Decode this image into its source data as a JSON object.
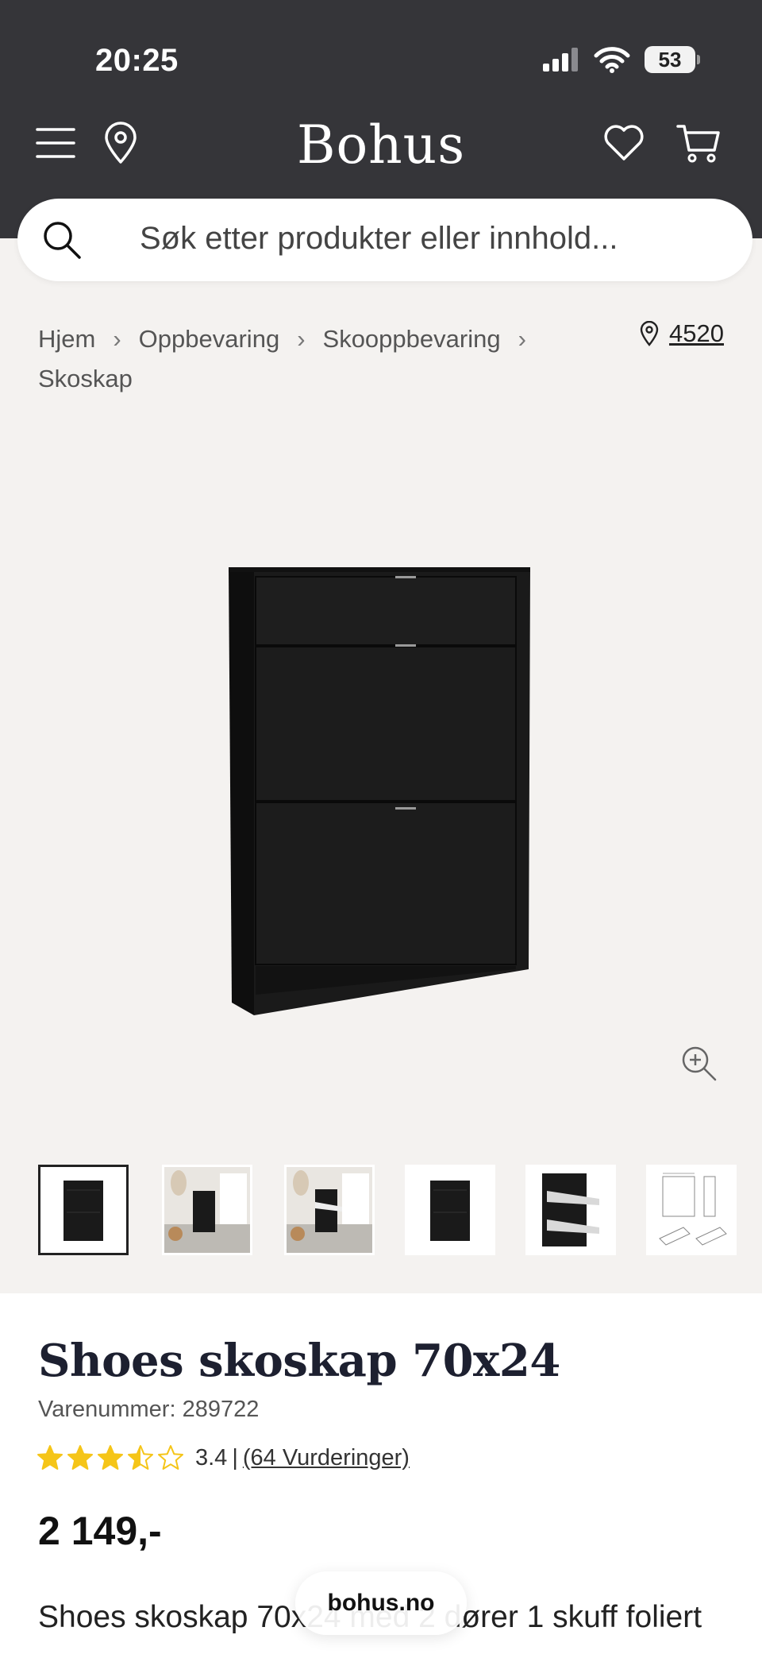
{
  "status_bar": {
    "time": "20:25",
    "battery": "53"
  },
  "header": {
    "logo": "Bohus",
    "search_placeholder": "Søk etter produkter eller innhold..."
  },
  "breadcrumb": {
    "items": [
      "Hjem",
      "Oppbevaring",
      "Skooppbevaring",
      "Skoskap"
    ],
    "store_postcode": "4520"
  },
  "product": {
    "title": "Shoes skoskap 70x24",
    "sku": "Varenummer: 289722",
    "rating_value": 3.4,
    "rating_display": "3.4",
    "rating_separator": "|",
    "reviews_link": "(64 Vurderinger)",
    "price": "2 149,-",
    "description": "Shoes skoskap 70x24 med 2 dører 1 skuff foliert"
  },
  "thumbnails": [
    {
      "label": "front",
      "active": true
    },
    {
      "label": "room-closed",
      "active": false
    },
    {
      "label": "room-open",
      "active": false
    },
    {
      "label": "front-alt",
      "active": false
    },
    {
      "label": "open-doors",
      "active": false
    },
    {
      "label": "dimensions",
      "active": false
    }
  ],
  "browser": {
    "url": "bohus.no"
  },
  "colors": {
    "header_bg": "#353539",
    "page_bg": "#f4f2f0",
    "star": "#f5c518",
    "title": "#1d2030"
  }
}
